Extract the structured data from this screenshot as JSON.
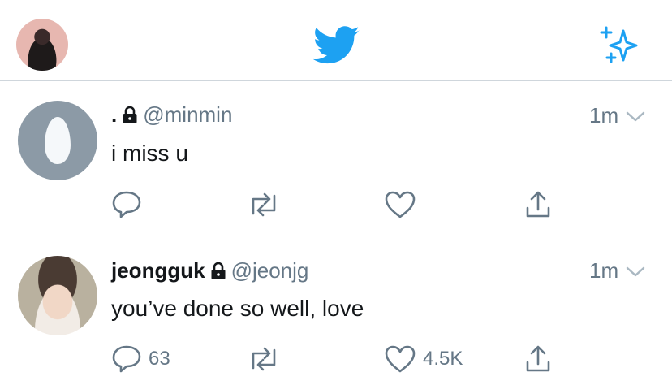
{
  "header": {
    "avatar_icon": "profile-avatar",
    "logo_icon": "twitter-bird-icon",
    "sparkle_icon": "sparkle-icon"
  },
  "tweets": [
    {
      "name": ".",
      "handle": "@minmin",
      "time": "1m",
      "text": "i miss u",
      "reply_count": "",
      "retweet_count": "",
      "like_count": ""
    },
    {
      "name": "jeongguk",
      "handle": "@jeonjg",
      "time": "1m",
      "text": "you’ve done so well, love",
      "reply_count": "63",
      "retweet_count": "",
      "like_count": "4.5K"
    }
  ],
  "colors": {
    "brand": "#1da1f2",
    "muted": "#657786",
    "divider": "#cfd6dc"
  }
}
